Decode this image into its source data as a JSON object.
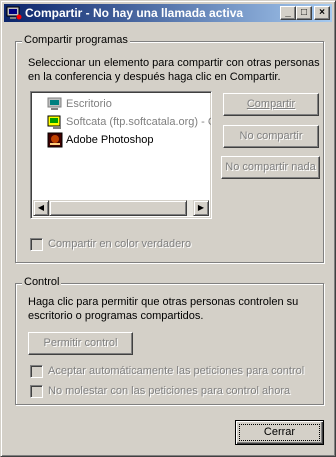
{
  "window": {
    "title": "Compartir - No hay una llamada activa",
    "minimize_glyph": "_",
    "maximize_glyph": "□",
    "close_glyph": "×"
  },
  "share_programs": {
    "group_label": "Compartir programas",
    "description_line1": "Seleccionar un elemento para compartir con otras personas",
    "description_line2": "en la conferencia y después haga clic en Compartir.",
    "items": [
      {
        "label": "Escritorio",
        "icon": "desktop-icon"
      },
      {
        "label": "Softcata (ftp.softcatala.org) - Co",
        "icon": "ftp-client-icon"
      },
      {
        "label": "Adobe Photoshop",
        "icon": "photoshop-icon"
      }
    ],
    "share_button": "Compartir",
    "unshare_button": "No compartir",
    "unshare_all_button": "No compartir nada",
    "true_color_checkbox": "Compartir en color verdadero",
    "scroll_left_glyph": "◀",
    "scroll_right_glyph": "▶"
  },
  "control": {
    "group_label": "Control",
    "description_line1": "Haga clic para permitir que otras personas controlen su",
    "description_line2": "escritorio o programas compartidos.",
    "allow_control_button": "Permitir control",
    "auto_accept_checkbox": "Aceptar automáticamente las peticiones para control",
    "do_not_disturb_checkbox": "No molestar con las peticiones para control ahora"
  },
  "close_button": "Cerrar",
  "colors": {
    "title_gradient_start": "#0a246a",
    "title_gradient_end": "#a6caf0",
    "face": "#d4d0c8",
    "disabled_text": "#808080"
  }
}
